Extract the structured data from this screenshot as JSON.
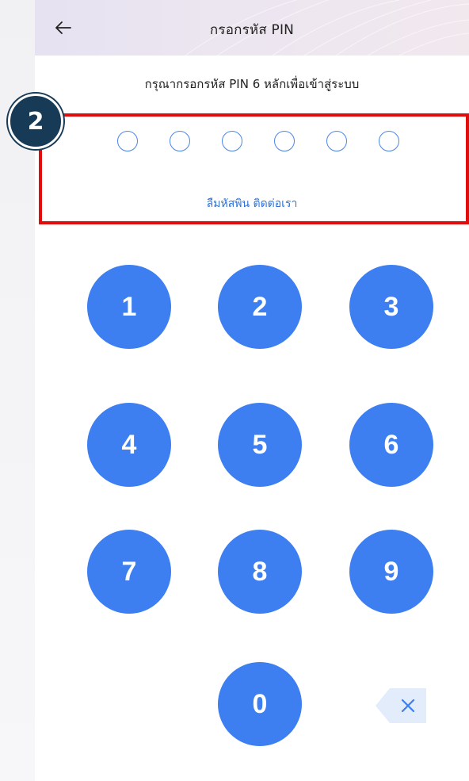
{
  "header": {
    "title": "กรอกรหัส PIN",
    "back_icon": "arrow-left-icon"
  },
  "pin": {
    "prompt": "กรุณากรอกรหัส PIN 6 หลักเพื่อเข้าสู่ระบบ",
    "length": 6,
    "filled": 0,
    "forgot_link": "ลืมหัสพิน ติดต่อเรา"
  },
  "keypad": {
    "k1": "1",
    "k2": "2",
    "k3": "3",
    "k4": "4",
    "k5": "5",
    "k6": "6",
    "k7": "7",
    "k8": "8",
    "k9": "9",
    "k0": "0",
    "backspace_icon": "backspace-icon"
  },
  "annotation": {
    "step_number": "2"
  },
  "colors": {
    "accent": "#3d7ff0",
    "link": "#2f72d8",
    "highlight": "#e00d0d",
    "badge": "#173a57"
  }
}
